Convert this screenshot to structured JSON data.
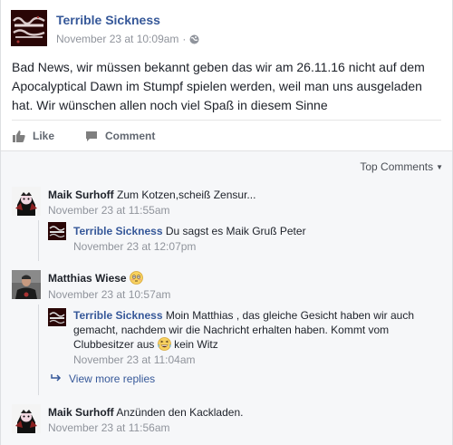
{
  "post": {
    "page_name": "Terrible Sickness",
    "timestamp": "November 23 at 10:09am",
    "separator": "·",
    "text": "Bad News, wir müssen bekannt geben das wir am 26.11.16 nicht auf dem Apocalyptical Dawn im Stumpf spielen werden, weil man uns ausgeladen hat. Wir wünschen allen noch viel Spaß in diesem Sinne"
  },
  "actions": {
    "like": "Like",
    "comment": "Comment"
  },
  "comments": {
    "sort_label": "Top Comments",
    "items": [
      {
        "author": "Maik Surhoff",
        "text": "Zum Kotzen,scheiß Zensur...",
        "time": "November 23 at 11:55am"
      },
      {
        "author": "Terrible Sickness",
        "text": "Du sagst es Maik Gruß Peter",
        "time": "November 23 at 12:07pm"
      },
      {
        "author": "Matthias Wiese",
        "text": "",
        "time": "November 23 at 10:57am"
      },
      {
        "author": "Terrible Sickness",
        "text_1": "Moin Matthias , das gleiche Gesicht haben wir auch gemacht, nachdem wir die Nachricht erhalten haben. Kommt vom Clubbesitzer aus",
        "text_2": "kein Witz",
        "time": "November 23 at 11:04am"
      },
      {
        "author": "Maik Surhoff",
        "text": "Anzünden den Kackladen.",
        "time": "November 23 at 11:56am"
      }
    ],
    "view_more": "View more replies"
  },
  "colors": {
    "link": "#365899",
    "meta": "#90949c",
    "comments_bg": "#f6f7f9",
    "band_avatar_bg": "#2a0606"
  },
  "icons": [
    "globe-icon",
    "like-icon",
    "comment-icon",
    "caret-down-icon",
    "reply-arrow-icon",
    "flushed-face-emoji",
    "laughing-emoji"
  ]
}
